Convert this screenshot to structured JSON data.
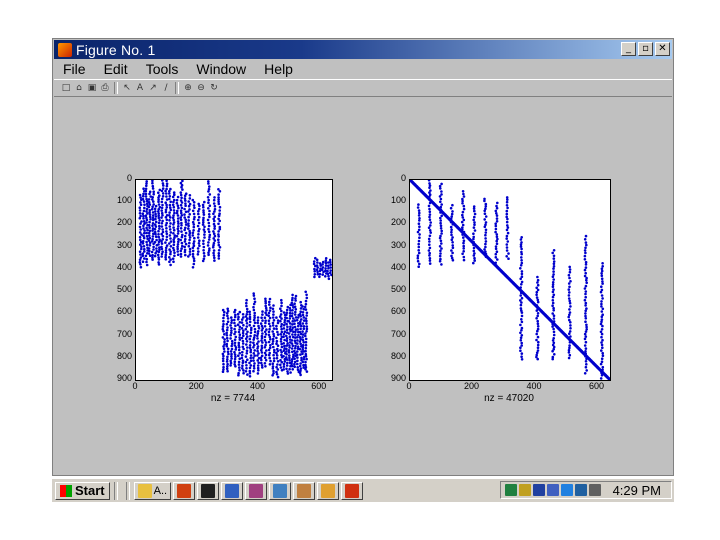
{
  "window": {
    "title": "Figure No. 1",
    "controls": {
      "minimize": "_",
      "maximize": "▫",
      "close": "✕"
    }
  },
  "menu": [
    "File",
    "Edit",
    "Tools",
    "Window",
    "Help"
  ],
  "toolbar": {
    "icons": [
      "new-file-icon",
      "open-icon",
      "save-icon",
      "print-icon",
      "select-arrow-icon",
      "text-icon",
      "arrow-icon",
      "line-icon",
      "zoom-in-icon",
      "zoom-out-icon",
      "rotate-icon"
    ],
    "glyphs": [
      "□",
      "⌂",
      "▣",
      "⎙",
      "↖",
      "A",
      "↗",
      "/",
      "⊕",
      "⊖",
      "↻"
    ]
  },
  "chart_data": [
    {
      "type": "scatter",
      "title": "",
      "xlabel": "nz = 7744",
      "ylabel": "",
      "xlim": [
        0,
        640
      ],
      "ylim": [
        900,
        0
      ],
      "xticks": [
        "0",
        "200",
        "400",
        "600"
      ],
      "xtick_values": [
        0,
        200,
        400,
        600
      ],
      "yticks": [
        "0",
        "100",
        "200",
        "300",
        "400",
        "500",
        "600",
        "700",
        "800",
        "900"
      ],
      "ytick_values": [
        0,
        100,
        200,
        300,
        400,
        500,
        600,
        700,
        800,
        900
      ],
      "color": "#0000cc",
      "pattern": "sparsity",
      "blocks": [
        {
          "x": [
            10,
            80
          ],
          "y": [
            0,
            400
          ]
        },
        {
          "x": [
            80,
            180
          ],
          "y": [
            0,
            400
          ]
        },
        {
          "x": [
            180,
            280
          ],
          "y": [
            0,
            400
          ]
        },
        {
          "x": [
            280,
            380
          ],
          "y": [
            500,
            900
          ]
        },
        {
          "x": [
            380,
            480
          ],
          "y": [
            500,
            900
          ]
        },
        {
          "x": [
            480,
            560
          ],
          "y": [
            500,
            900
          ]
        },
        {
          "x": [
            580,
            640
          ],
          "y": [
            350,
            450
          ]
        }
      ]
    },
    {
      "type": "scatter",
      "title": "",
      "xlabel": "nz = 47020",
      "ylabel": "",
      "xlim": [
        0,
        640
      ],
      "ylim": [
        900,
        0
      ],
      "xticks": [
        "0",
        "200",
        "400",
        "600"
      ],
      "xtick_values": [
        0,
        200,
        400,
        600
      ],
      "yticks": [
        "0",
        "100",
        "200",
        "300",
        "400",
        "500",
        "600",
        "700",
        "800",
        "900"
      ],
      "ytick_values": [
        0,
        100,
        200,
        300,
        400,
        500,
        600,
        700,
        800,
        900
      ],
      "color": "#0000cc",
      "pattern": "sparsity-diagonal",
      "blocks": [
        {
          "x": [
            10,
            330
          ],
          "y": [
            0,
            400
          ]
        },
        {
          "x": [
            330,
            640
          ],
          "y": [
            250,
            900
          ]
        }
      ]
    }
  ],
  "taskbar": {
    "start_label": "Start",
    "tasks": [
      {
        "icon": "folder-icon",
        "label": "A..",
        "color": "#e8c040"
      },
      {
        "icon": "matlab-icon",
        "label": "",
        "color": "#d04010"
      },
      {
        "icon": "terminal-icon",
        "label": "",
        "color": "#202020"
      },
      {
        "icon": "document-icon",
        "label": "",
        "color": "#3060c0"
      },
      {
        "icon": "paint-icon",
        "label": "",
        "color": "#a04080"
      },
      {
        "icon": "image-icon",
        "label": "",
        "color": "#4080c0"
      },
      {
        "icon": "file-icon",
        "label": "",
        "color": "#c08040"
      },
      {
        "icon": "page-icon",
        "label": "",
        "color": "#e0a030"
      },
      {
        "icon": "figure-icon",
        "label": "",
        "color": "#d03010"
      }
    ],
    "tray_icons": [
      {
        "icon": "network-icon",
        "color": "#208040"
      },
      {
        "icon": "volume-icon",
        "color": "#c0a020"
      },
      {
        "icon": "shield-icon",
        "color": "#2040a0"
      },
      {
        "icon": "monitor-icon",
        "color": "#4060c0"
      },
      {
        "icon": "eye-icon",
        "color": "#2080e0"
      },
      {
        "icon": "globe-icon",
        "color": "#2060a0"
      },
      {
        "icon": "printer-icon",
        "color": "#606060"
      }
    ],
    "clock": "4:29 PM"
  }
}
